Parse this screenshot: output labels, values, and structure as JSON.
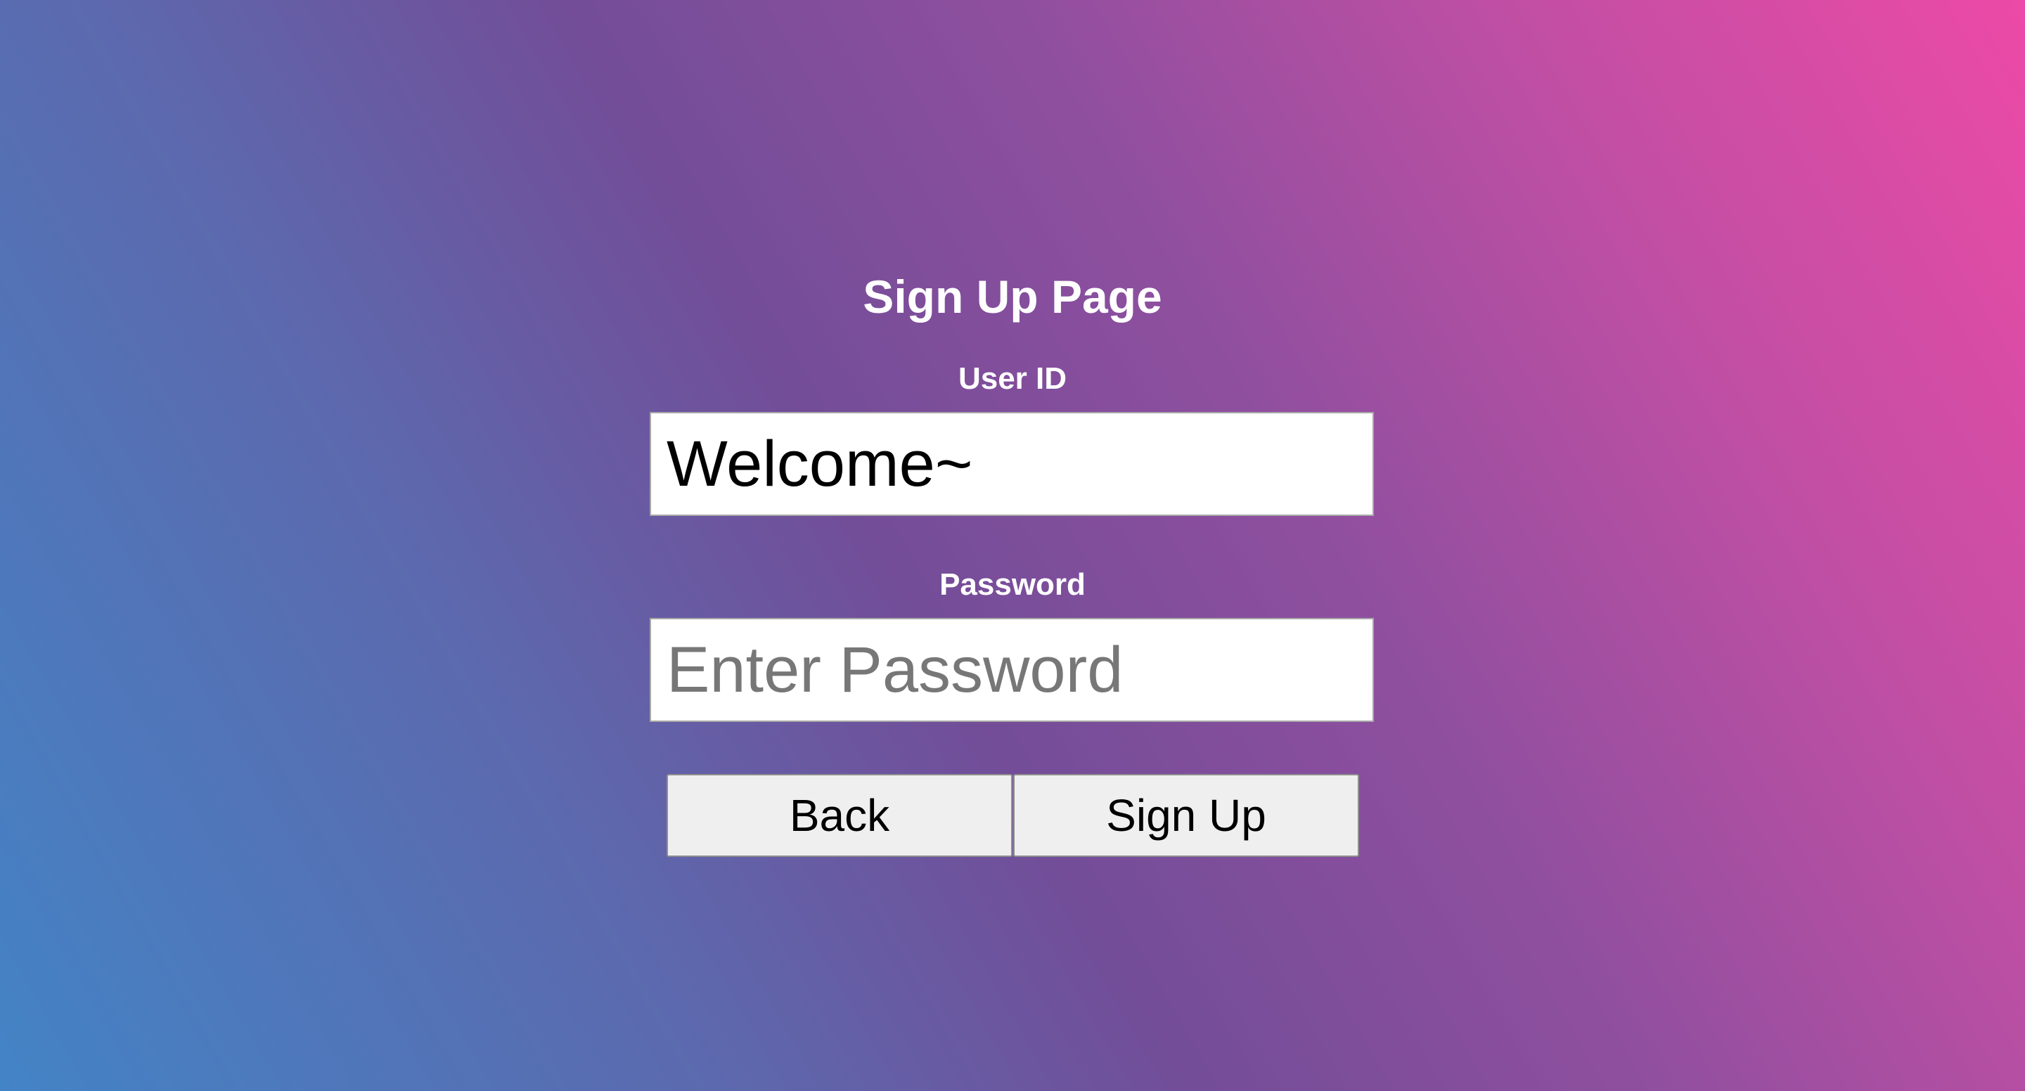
{
  "page": {
    "title": "Sign Up Page"
  },
  "form": {
    "user_id": {
      "label": "User ID",
      "value": "Welcome~"
    },
    "password": {
      "label": "Password",
      "value": "",
      "placeholder": "Enter Password"
    }
  },
  "buttons": {
    "back_label": "Back",
    "signup_label": "Sign Up"
  },
  "colors": {
    "gradient_start": "#4384c6",
    "gradient_mid": "#734d98",
    "gradient_end": "#ec4aa6",
    "text_light": "#ffffff",
    "button_bg": "#efefef"
  }
}
